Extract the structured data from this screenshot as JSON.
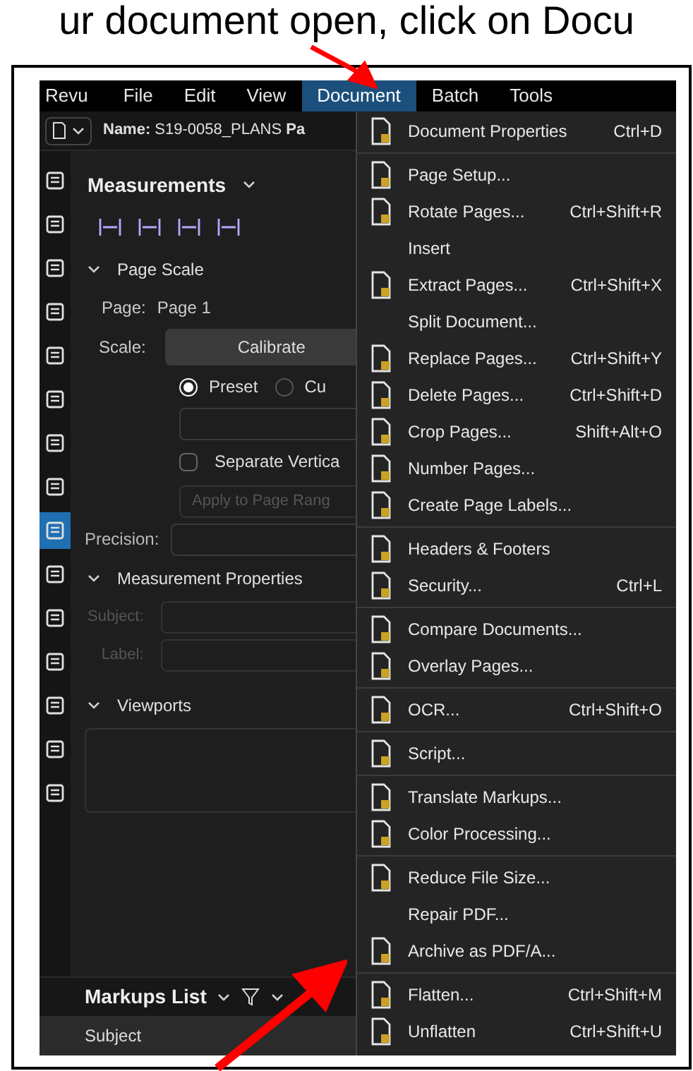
{
  "caption": "ur document open, click on Docu",
  "menubar": [
    {
      "label": "Revu",
      "selected": false
    },
    {
      "label": "File",
      "selected": false
    },
    {
      "label": "Edit",
      "selected": false
    },
    {
      "label": "View",
      "selected": false
    },
    {
      "label": "Document",
      "selected": true
    },
    {
      "label": "Batch",
      "selected": false
    },
    {
      "label": "Tools",
      "selected": false
    }
  ],
  "toolbar": {
    "name": "**Name:** S19-0058_PLANS **Pa**"
  },
  "rail": [
    {
      "selected": false
    },
    {
      "selected": false
    },
    {
      "selected": false
    },
    {
      "selected": false
    },
    {
      "selected": false
    },
    {
      "selected": false
    },
    {
      "selected": false
    },
    {
      "selected": false
    },
    {
      "selected": true
    },
    {
      "selected": false
    },
    {
      "selected": false
    },
    {
      "selected": false
    },
    {
      "selected": false
    },
    {
      "selected": false
    },
    {
      "selected": false
    }
  ],
  "panel": {
    "title": "Measurements",
    "page_scale": {
      "heading": "Page Scale",
      "page_label": "Page:",
      "page_value": "Page 1",
      "scale_label": "Scale:",
      "calibrate": "Calibrate",
      "radios": [
        {
          "label": "Preset",
          "selected": true
        },
        {
          "label": "Cu",
          "selected": false
        }
      ],
      "separate": {
        "label": "Separate Vertica",
        "checked": false
      },
      "apply": {
        "placeholder": "Apply to Page Rang"
      },
      "precision_label": "Precision:"
    },
    "measurement_properties": {
      "heading": "Measurement Properties",
      "subject_label": "Subject:",
      "label_label": "Label:"
    },
    "viewports": {
      "heading": "Viewports"
    }
  },
  "markups": {
    "title": "Markups List",
    "columns": [
      "Subject"
    ]
  },
  "menu": [
    {
      "kind": "icon",
      "label": "Document Properties",
      "shortcut": "Ctrl+D"
    },
    {
      "kind": "separator"
    },
    {
      "kind": "icon",
      "label": "Page Setup..."
    },
    {
      "kind": "icon",
      "label": "Rotate Pages...",
      "shortcut": "Ctrl+Shift+R"
    },
    {
      "kind": "plain",
      "label": "Insert"
    },
    {
      "kind": "icon",
      "label": "Extract Pages...",
      "shortcut": "Ctrl+Shift+X"
    },
    {
      "kind": "plain",
      "label": "Split Document..."
    },
    {
      "kind": "icon",
      "label": "Replace Pages...",
      "shortcut": "Ctrl+Shift+Y"
    },
    {
      "kind": "icon",
      "label": "Delete Pages...",
      "shortcut": "Ctrl+Shift+D"
    },
    {
      "kind": "icon",
      "label": "Crop Pages...",
      "shortcut": "Shift+Alt+O"
    },
    {
      "kind": "icon",
      "label": "Number Pages..."
    },
    {
      "kind": "icon",
      "label": "Create Page Labels..."
    },
    {
      "kind": "separator"
    },
    {
      "kind": "icon",
      "label": "Headers & Footers"
    },
    {
      "kind": "icon",
      "label": "Security...",
      "shortcut": "Ctrl+L"
    },
    {
      "kind": "separator"
    },
    {
      "kind": "icon",
      "label": "Compare Documents..."
    },
    {
      "kind": "icon",
      "label": "Overlay Pages..."
    },
    {
      "kind": "separator"
    },
    {
      "kind": "icon",
      "label": "OCR...",
      "shortcut": "Ctrl+Shift+O"
    },
    {
      "kind": "separator"
    },
    {
      "kind": "icon",
      "label": "Script..."
    },
    {
      "kind": "separator"
    },
    {
      "kind": "icon",
      "label": "Translate Markups..."
    },
    {
      "kind": "icon",
      "label": "Color Processing..."
    },
    {
      "kind": "separator"
    },
    {
      "kind": "icon",
      "label": "Reduce File Size..."
    },
    {
      "kind": "plain",
      "label": "Repair PDF..."
    },
    {
      "kind": "icon",
      "label": "Archive as PDF/A..."
    },
    {
      "kind": "separator"
    },
    {
      "kind": "icon",
      "label": "Flatten...",
      "shortcut": "Ctrl+Shift+M"
    },
    {
      "kind": "icon",
      "label": "Unflatten",
      "shortcut": "Ctrl+Shift+U"
    }
  ]
}
